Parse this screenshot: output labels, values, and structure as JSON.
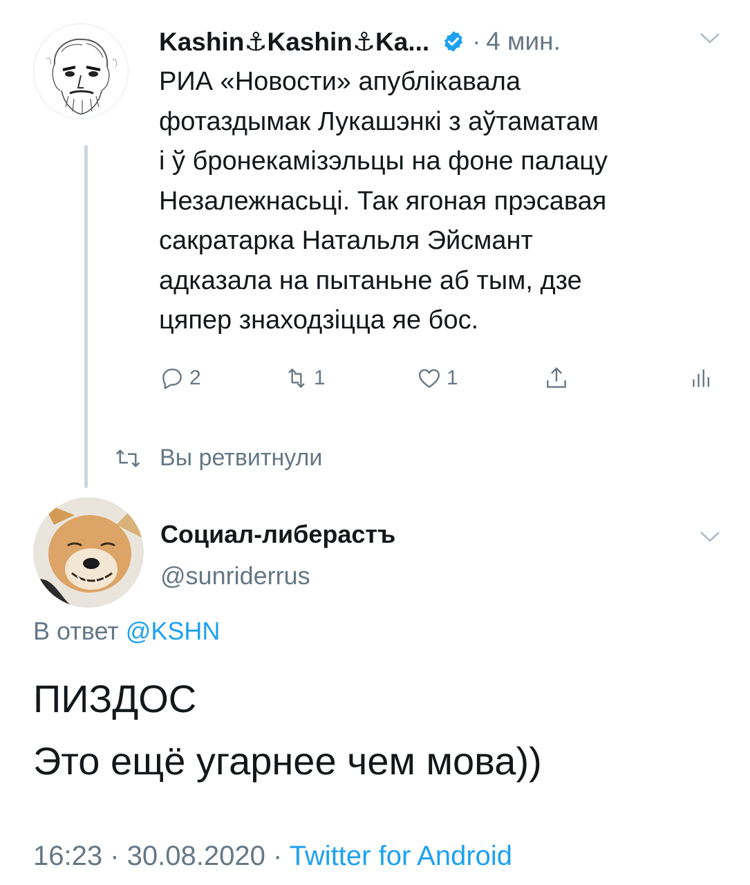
{
  "quoted_tweet": {
    "author_name": "Kashin⚓Kashin⚓Ka...",
    "verified": true,
    "separator": "·",
    "time": "4 мин.",
    "text_lines": [
      "РИА «Новости» апублікавала",
      "фотаздымак Лукашэнкі з аўтаматам",
      "і ў бронекамізэльцы на фоне палацу",
      "Незалежнасьці. Так ягоная прэсавая",
      "сакратарка Натальля Эйсмант",
      "адказала на пытаньне аб тым, дзе",
      "цяпер знаходзіцца яе бос."
    ],
    "actions": {
      "replies": "2",
      "retweets": "1",
      "likes": "1"
    },
    "retweeted_label": "Вы ретвитнули"
  },
  "reply_tweet": {
    "author_name": "Социал-либерастъ",
    "handle": "@sunriderrus",
    "reply_prefix": "В ответ",
    "reply_mention": "@KSHN",
    "text_line1": "ПИЗДОС",
    "text_line2": "Это ещё угарнее чем мова))",
    "timestamp": "16:23 · 30.08.2020 · ",
    "source": "Twitter for Android"
  },
  "colors": {
    "primary_text": "#14171a",
    "secondary_text": "#657786",
    "link_blue": "#1da1f2",
    "thread_line": "#ccd6dd"
  },
  "icons": [
    "verified-badge-icon",
    "chevron-down-icon",
    "reply-icon",
    "retweet-icon",
    "like-icon",
    "share-icon",
    "analytics-icon"
  ]
}
